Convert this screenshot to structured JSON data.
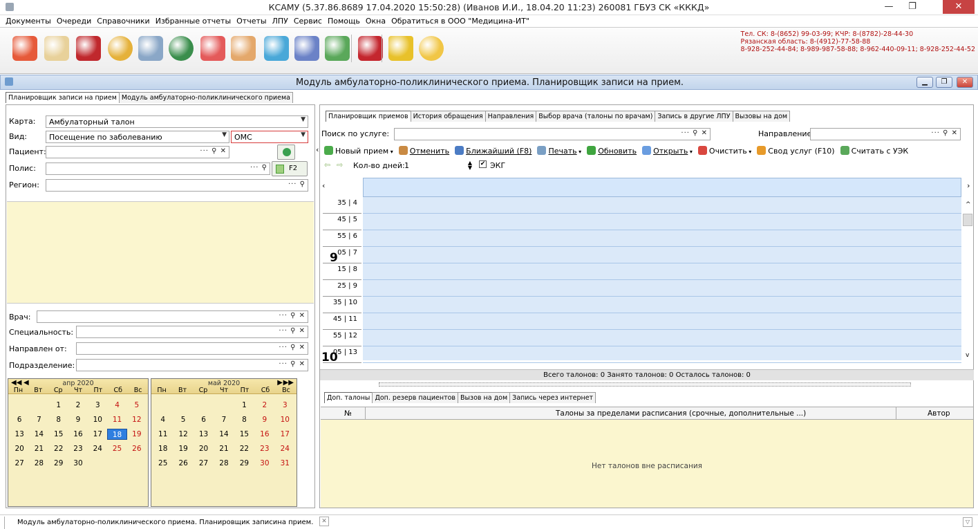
{
  "window": {
    "title": "КСАМУ (5.37.86.8689 17.04.2020 15:50:28) (Иванов И.И., 18.04.20 11:23)  260081 ГБУЗ СК «КККД»"
  },
  "menu": [
    "Документы",
    "Очереди",
    "Справочники",
    "Избранные отчеты",
    "Отчеты",
    "ЛПУ",
    "Сервис",
    "Помощь",
    "Окна",
    "Обратиться в ООО \"Медицина-ИТ\""
  ],
  "toolbar_icons": [
    {
      "name": "calendar-icon",
      "color": "#e65a3a"
    },
    {
      "name": "document-icon",
      "color": "#e8d19a"
    },
    {
      "name": "book-icon",
      "color": "#c0282d"
    },
    {
      "name": "coins-icon",
      "color": "#e5b13a"
    },
    {
      "name": "syringe-icon",
      "color": "#8aa7c7"
    },
    {
      "name": "globe-icon",
      "color": "#3a8e4c"
    },
    {
      "name": "first-aid-icon",
      "color": "#e45a5a"
    },
    {
      "name": "doctor-icon",
      "color": "#e4a86b"
    },
    {
      "name": "pill-icon",
      "color": "#4aa8d8"
    },
    {
      "name": "schedule-icon",
      "color": "#6b82c7"
    },
    {
      "name": "network-icon",
      "color": "#5aa85a"
    },
    {
      "name": "acrobat-icon",
      "color": "#c4262e"
    },
    {
      "name": "lock-icon",
      "color": "#e8c12a"
    },
    {
      "name": "chat-icon",
      "color": "#f1c646"
    }
  ],
  "contacts": [
    "Тел. СК: 8-(8652) 99-03-99; КЧР: 8-(8782)-28-44-30",
    "Рязанская область: 8-(4912)-77-58-88",
    "8-928-252-44-84; 8-989-987-58-88; 8-962-440-09-11; 8-928-252-44-52"
  ],
  "module": {
    "title": "Модуль амбулаторно-поликлинического приема. Планировщик записи на прием."
  },
  "top_tabs": [
    "Планировщик записи на прием",
    "Модуль амбулаторно-поликлинического приема"
  ],
  "form": {
    "karta_label": "Карта:",
    "karta_value": "Амбулаторный талон",
    "vid_label": "Вид:",
    "vid_value": "Посещение по заболеванию",
    "oms_value": "ОМС",
    "patient_label": "Пациент:",
    "polis_label": "Полис:",
    "region_label": "Регион:",
    "f2_label": "F2",
    "vrach_label": "Врач:",
    "spec_label": "Специальность:",
    "napr_label": "Направлен от:",
    "podr_label": "Подразделение:"
  },
  "calendar": {
    "dow": [
      "Пн",
      "Вт",
      "Ср",
      "Чт",
      "Пт",
      "Сб",
      "Вс"
    ],
    "months": [
      {
        "name": "апр 2020",
        "offset": 2,
        "days": 30,
        "today": 18
      },
      {
        "name": "май 2020",
        "offset": 4,
        "days": 31,
        "today": 0
      }
    ]
  },
  "right_tabs": [
    "Планировщик приемов",
    "История обращения",
    "Направления",
    "Выбор врача (талоны по врачам)",
    "Запись в другие ЛПУ",
    "Вызовы на дом"
  ],
  "search": {
    "service_label": "Поиск по услуге:",
    "direction_label": "Направление:"
  },
  "actions": [
    "Новый прием",
    "Отменить",
    "Ближайший (F8)",
    "Печать",
    "Обновить",
    "Открыть",
    "Очистить",
    "Свод услуг (F10)",
    "Считать с УЭК"
  ],
  "action_colors": [
    "#4bab4b",
    "#c98a43",
    "#4c7cc4",
    "#7a9fc4",
    "#3fa53f",
    "#6a9de0",
    "#d9473f",
    "#e79a2a",
    "#5aa85a"
  ],
  "days_row": {
    "label": "Кол-во дней:",
    "value": "1",
    "ekg_label": "ЭКГ"
  },
  "schedule": {
    "slots": [
      "35 | 4",
      "45 | 5",
      "55 | 6",
      "05 | 7",
      "15 | 8",
      "25 | 9",
      "35 | 10",
      "45 | 11",
      "55 | 12",
      "05 | 13"
    ],
    "hours": [
      {
        "slot": 3,
        "hour": "9"
      },
      {
        "slot": 9,
        "hour": "10"
      }
    ]
  },
  "summary": "Всего талонов: 0  Занято талонов: 0  Осталось талонов: 0",
  "bottom_tabs": [
    "Доп. талоны",
    "Доп. резерв пациентов",
    "Вызов на дом",
    "Запись через интернет"
  ],
  "bottom_table": {
    "col_num": "№",
    "col_main": "Талоны за пределами расписания (срочные, дополнительные ...)",
    "col_author": "Автор",
    "empty": "Нет талонов вне расписания"
  },
  "status": {
    "tab_label": "Модуль амбулаторно-поликлинического приема. Планировщик записина прием."
  }
}
